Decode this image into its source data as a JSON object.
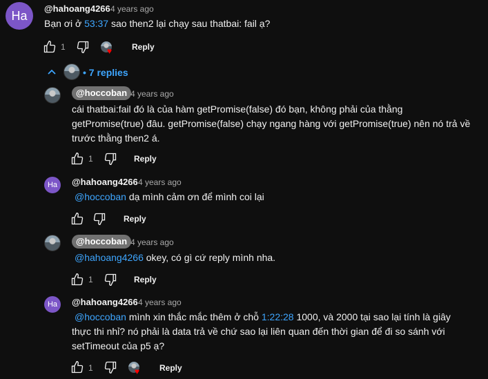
{
  "top_comment": {
    "avatar_initials": "Ha",
    "author": "@hahoang4266",
    "time": "4 years ago",
    "text_before": "Bạn ơi ở ",
    "timestamp_link": "53:37",
    "text_after": " sao then2 lại chạy sau thatbai: fail ạ?",
    "like_count": "1",
    "reply_label": "Reply"
  },
  "replies_toggle": {
    "label": "• 7 replies"
  },
  "replies": [
    {
      "author": "@hoccoban",
      "time": "4 years ago",
      "text_lines": [
        "cái thatbai:fail đó là của hàm getPromise(false) đó bạn, không phải của thằng",
        "getPromise(true) đâu. getPromise(false) chạy ngang hàng với getPromise(true) nên nó trả về",
        "trước thằng then2 á."
      ],
      "like_count": "1",
      "reply_label": "Reply"
    },
    {
      "avatar_initials": "Ha",
      "author": "@hahoang4266",
      "time": "4 years ago",
      "mention": "@hoccoban",
      "text": " dạ mình cảm ơn để mình coi lại",
      "reply_label": "Reply"
    },
    {
      "author": "@hoccoban",
      "time": "4 years ago",
      "mention": "@hahoang4266",
      "text": " okey, có gì cứ reply mình nha.",
      "like_count": "1",
      "reply_label": "Reply"
    },
    {
      "avatar_initials": "Ha",
      "author": "@hahoang4266",
      "time": "4 years ago",
      "mention": "@hoccoban",
      "text_mid": " mình xin thắc mắc thêm ở chỗ ",
      "timestamp_link": "1:22:28",
      "text_end": " 1000, và 2000 tại sao lại tính là giây",
      "text_line2": "thực thi nhỉ? nó phải là data trả về chứ sao lại liên quan đến thời gian để đi so sánh với",
      "text_line3": "setTimeout của p5 ạ?",
      "like_count": "1",
      "reply_label": "Reply"
    }
  ],
  "colors": {
    "link": "#3ea6ff",
    "avatar": "#7c56c7",
    "heart": "#ff0000"
  }
}
